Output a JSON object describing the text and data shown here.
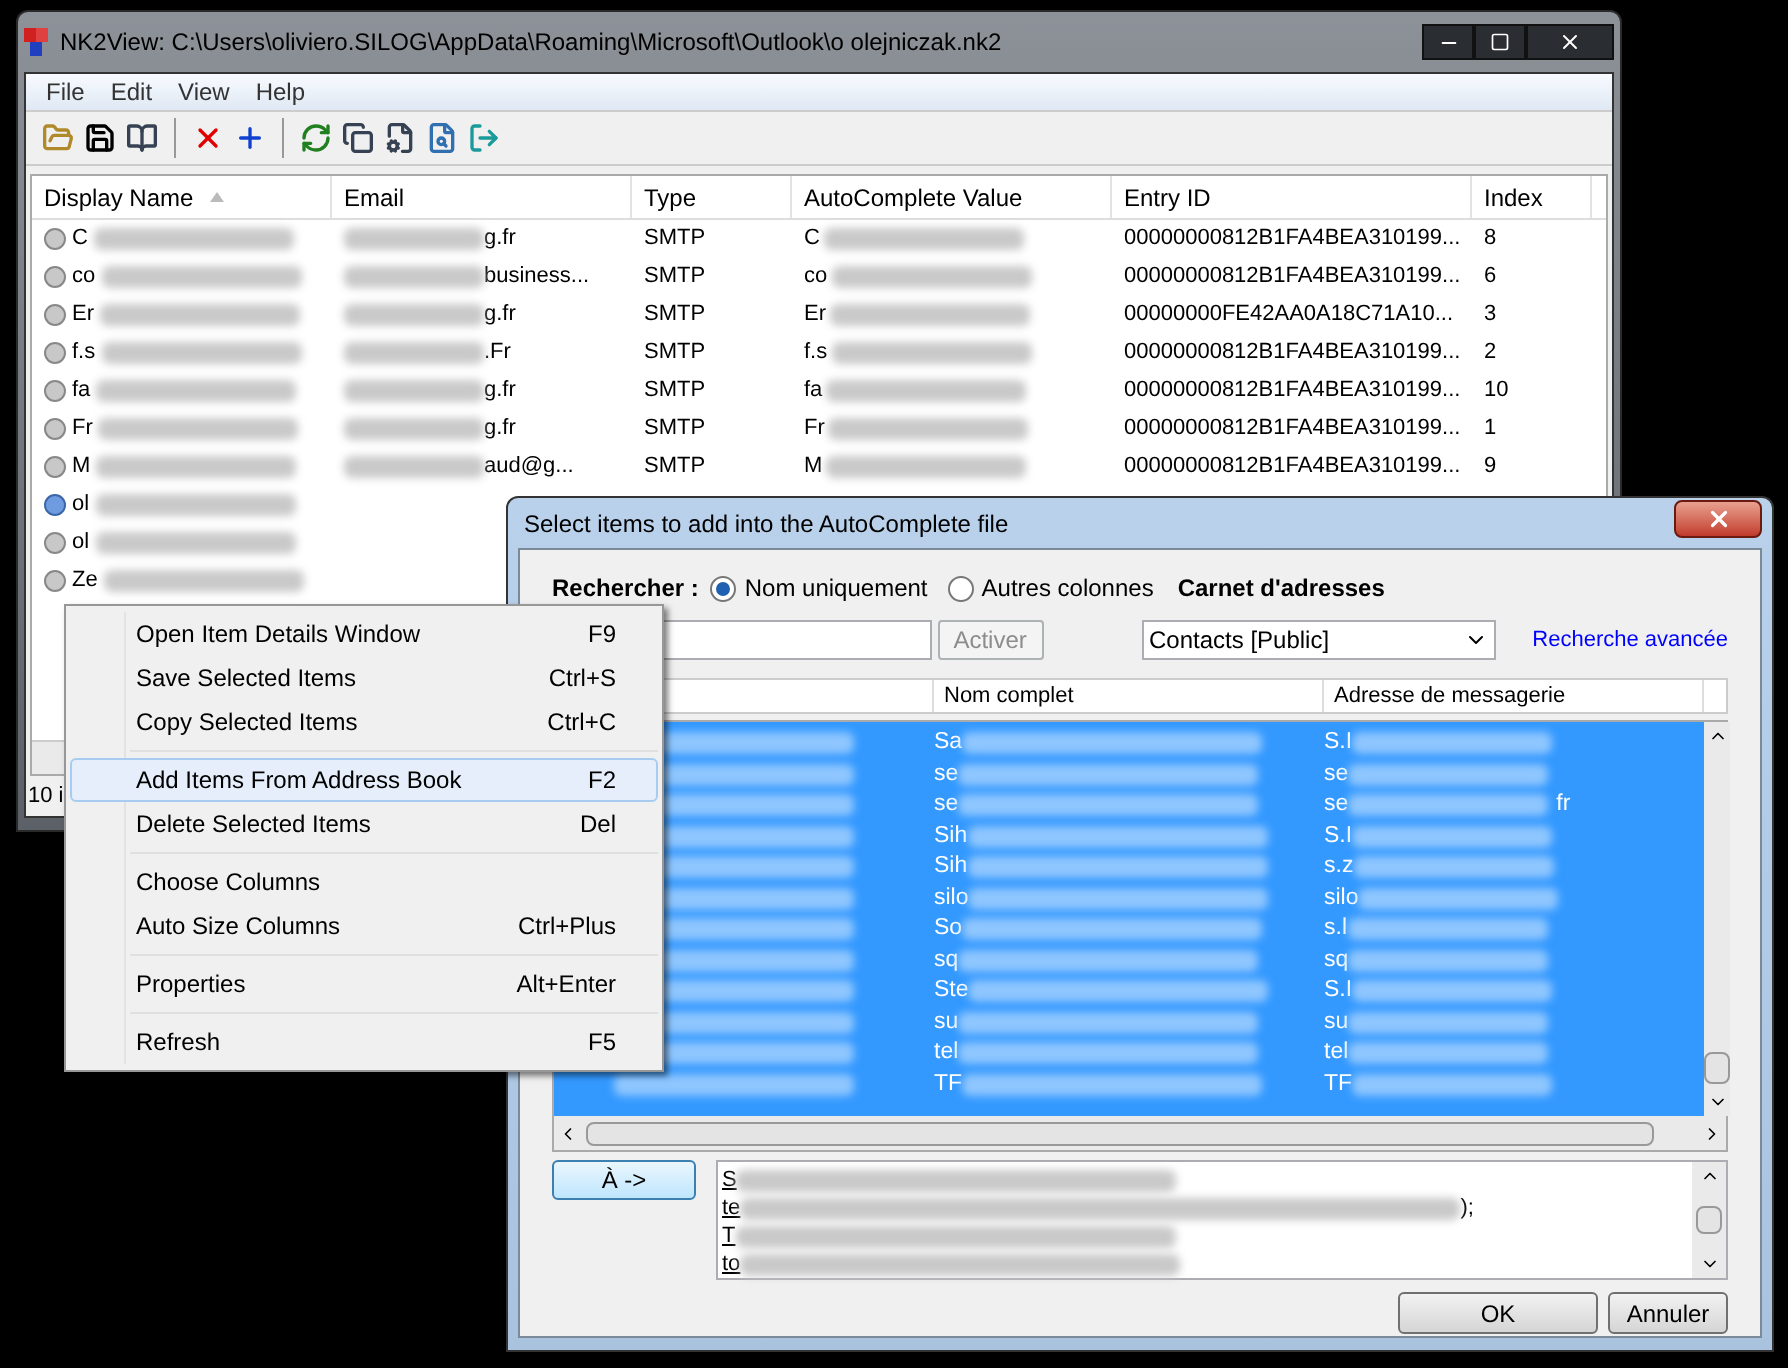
{
  "main_window": {
    "title": "NK2View:  C:\\Users\\oliviero.SILOG\\AppData\\Roaming\\Microsoft\\Outlook\\o olejniczak.nk2",
    "menu": [
      "File",
      "Edit",
      "View",
      "Help"
    ],
    "table": {
      "columns": [
        {
          "label": "Display Name",
          "sorted": true
        },
        {
          "label": "Email",
          "sorted": false
        },
        {
          "label": "Type",
          "sorted": false
        },
        {
          "label": "AutoComplete Value",
          "sorted": false
        },
        {
          "label": "Entry ID",
          "sorted": false
        },
        {
          "label": "Index",
          "sorted": false
        }
      ],
      "rows": [
        {
          "kind": "contact",
          "name": "C",
          "email": "g.fr",
          "type": "SMTP",
          "value": "C",
          "entry_id": "00000000812B1FA4BEA310199...",
          "index": "8"
        },
        {
          "kind": "contact",
          "name": "co",
          "email": "business...",
          "type": "SMTP",
          "value": "co",
          "entry_id": "00000000812B1FA4BEA310199...",
          "index": "6"
        },
        {
          "kind": "contact",
          "name": "Er",
          "email": "g.fr",
          "type": "SMTP",
          "value": "Er",
          "entry_id": "00000000FE42AA0A18C71A10...",
          "index": "3"
        },
        {
          "kind": "contact",
          "name": "f.s",
          "email": ".Fr",
          "type": "SMTP",
          "value": "f.s",
          "entry_id": "00000000812B1FA4BEA310199...",
          "index": "2"
        },
        {
          "kind": "contact",
          "name": "fa",
          "email": "g.fr",
          "type": "SMTP",
          "value": "fa",
          "entry_id": "00000000812B1FA4BEA310199...",
          "index": "10"
        },
        {
          "kind": "contact",
          "name": "Fr",
          "email": "g.fr",
          "type": "SMTP",
          "value": "Fr",
          "entry_id": "00000000812B1FA4BEA310199...",
          "index": "1"
        },
        {
          "kind": "contact",
          "name": "M",
          "email": "aud@g...",
          "type": "SMTP",
          "value": "M",
          "entry_id": "00000000812B1FA4BEA310199...",
          "index": "9"
        },
        {
          "kind": "group",
          "name": "ol"
        },
        {
          "kind": "contact",
          "name": "ol"
        },
        {
          "kind": "contact",
          "name": "Ze"
        }
      ]
    },
    "status": "10 i"
  },
  "dialog": {
    "title": "Select items to add into the AutoComplete file",
    "search_label": "Rechercher :",
    "radios": [
      {
        "label": "Nom uniquement",
        "selected": true
      },
      {
        "label": "Autres colonnes",
        "selected": false
      }
    ],
    "address_book_label": "Carnet d'adresses",
    "activate_button": {
      "label": "Activer",
      "disabled": true
    },
    "address_book": "Contacts [Public]",
    "advanced_link": "Recherche avancée",
    "list": {
      "columns": [
        "Nom complet",
        "Adresse de messagerie"
      ],
      "rows": [
        {
          "name": "Sa",
          "address": "S.I",
          "selected": true
        },
        {
          "name": "se",
          "address": "se",
          "selected": true
        },
        {
          "name": "se",
          "address": "se",
          "address_tail": "fr",
          "selected": true
        },
        {
          "name": "Sih",
          "address": "S.I",
          "selected": true
        },
        {
          "name": "Sih",
          "address": "s.z",
          "selected": true
        },
        {
          "name": "silo",
          "address": "silo",
          "selected": true
        },
        {
          "name": "So",
          "address": "s.l",
          "selected": true
        },
        {
          "name": "sq",
          "address": "sq",
          "selected": true
        },
        {
          "name": "Ste",
          "address": "S.I",
          "selected": true
        },
        {
          "name": "su",
          "address": "su",
          "selected": true
        },
        {
          "name": "tel",
          "address": "tel",
          "selected": true
        },
        {
          "name": "TF",
          "address": "TF",
          "selected": true
        }
      ]
    },
    "to_button": "À ->",
    "recipients": [
      {
        "text": "S"
      },
      {
        "text": "te",
        "tail": ");"
      },
      {
        "text": "T"
      },
      {
        "text": "to"
      }
    ],
    "buttons": [
      "OK",
      "Annuler"
    ]
  },
  "context_menu": [
    [
      {
        "label": "Open Item Details Window",
        "shortcut": "F9",
        "selected": false
      },
      {
        "label": "Save Selected Items",
        "shortcut": "Ctrl+S",
        "selected": false
      },
      {
        "label": "Copy Selected Items",
        "shortcut": "Ctrl+C",
        "selected": false
      }
    ],
    [
      {
        "label": "Add Items From Address Book",
        "shortcut": "F2",
        "selected": true
      },
      {
        "label": "Delete Selected Items",
        "shortcut": "Del",
        "selected": false
      }
    ],
    [
      {
        "label": "Choose Columns",
        "selected": false
      },
      {
        "label": "Auto Size Columns",
        "shortcut": "Ctrl+Plus",
        "selected": false
      }
    ],
    [
      {
        "label": "Properties",
        "shortcut": "Alt+Enter",
        "selected": false
      }
    ],
    [
      {
        "label": "Refresh",
        "shortcut": "F5",
        "selected": false
      }
    ]
  ]
}
